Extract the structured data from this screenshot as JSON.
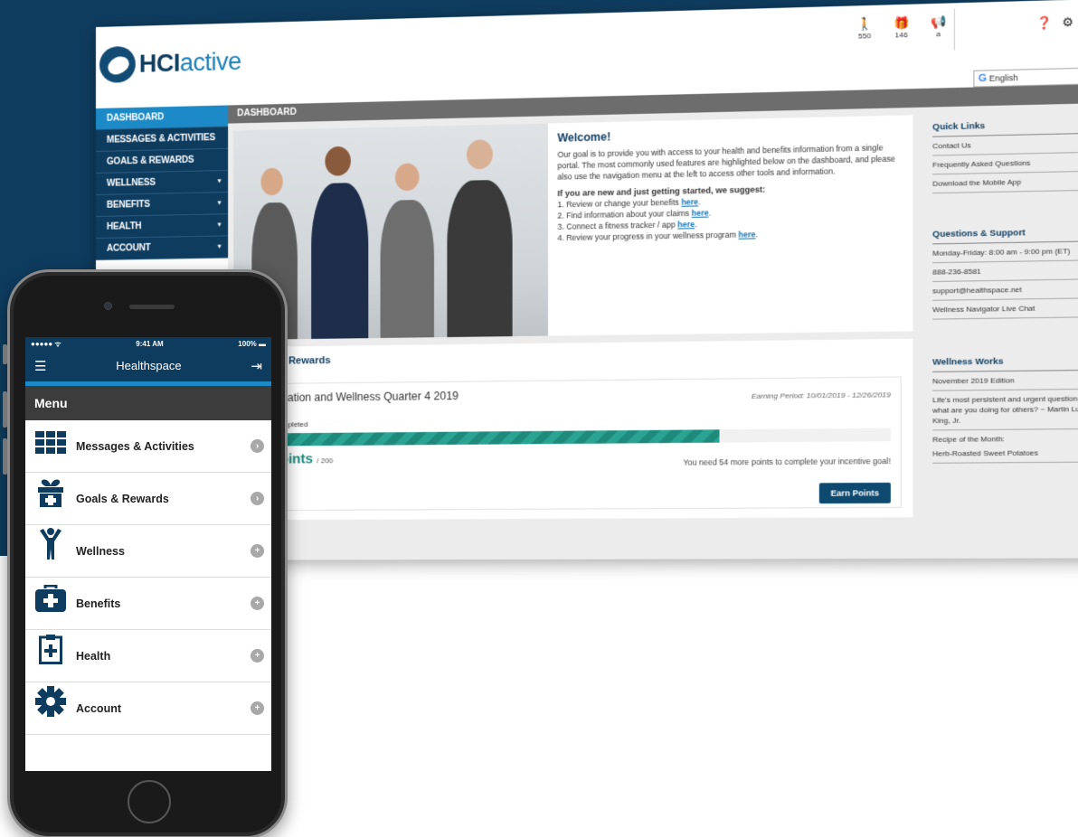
{
  "desktop": {
    "logo": {
      "bold": "HCI",
      "rest": "active"
    },
    "stats": [
      {
        "icon": "walker-icon",
        "glyph": "🚶",
        "value": "550"
      },
      {
        "icon": "gift-icon",
        "glyph": "🎁",
        "value": "146"
      },
      {
        "icon": "megaphone-icon",
        "glyph": "📢",
        "value": "a"
      }
    ],
    "language": {
      "g": "G",
      "label": "English",
      "caret": "▼"
    },
    "sidebar": [
      {
        "label": "DASHBOARD",
        "active": true,
        "arrow": ""
      },
      {
        "label": "MESSAGES & ACTIVITIES",
        "arrow": ""
      },
      {
        "label": "GOALS & REWARDS",
        "arrow": ""
      },
      {
        "label": "WELLNESS",
        "arrow": "▾"
      },
      {
        "label": "BENEFITS",
        "arrow": "▾"
      },
      {
        "label": "HEALTH",
        "arrow": "▾"
      },
      {
        "label": "ACCOUNT",
        "arrow": "▾"
      }
    ],
    "breadcrumb": "DASHBOARD",
    "welcome": {
      "title": "Welcome!",
      "body": "Our goal is to provide you with access to your health and benefits information from a single portal. The most commonly used features are highlighted below on the dashboard, and please also use the navigation menu at the left to access other tools and information.",
      "subtitle": "If you are new and just getting started, we suggest:",
      "steps": [
        {
          "text": "1. Review or change your benefits ",
          "link": "here",
          "end": "."
        },
        {
          "text": "2. Find information about your claims ",
          "link": "here",
          "end": "."
        },
        {
          "text": "3. Connect a fitness tracker / app ",
          "link": "here",
          "end": "."
        },
        {
          "text": "4. Review your progress in your wellness program ",
          "link": "here",
          "end": "."
        }
      ]
    },
    "rewards": {
      "title": "s & Rewards",
      "program": "cation and Wellness Quarter 4 2019",
      "earning_period": "Earning Period: 10/01/2019 - 12/26/2019",
      "completed_label": "mpleted",
      "progress_fraction": 0.73,
      "points_label": "oints",
      "points_total": "/ 200",
      "need_text": "You need 54 more points to complete your incentive goal!",
      "earn_button": "Earn Points"
    },
    "quick_links": {
      "title": "Quick Links",
      "items": [
        "Contact Us",
        "Frequently Asked Questions",
        "Download the Mobile App"
      ]
    },
    "support": {
      "title": "Questions & Support",
      "items": [
        "Monday-Friday: 8:00 am - 9:00 pm (ET)",
        "888-236-8581",
        "support@healthspace.net",
        "Wellness Navigator Live Chat"
      ]
    },
    "wellness_works": {
      "title": "Wellness Works",
      "items": [
        "November 2019 Edition",
        "Life's most persistent and urgent question is, what are you doing for others? ~ Martin Luther King, Jr.",
        "Recipe of the Month:",
        "Herb-Roasted Sweet Potatoes"
      ]
    }
  },
  "phone": {
    "status": {
      "signal": "●●●●● ᯤ",
      "time": "9:41 AM",
      "battery": "100% ▬"
    },
    "app_title": "Healthspace",
    "menu_glyph": "☰",
    "logout_glyph": "⇥",
    "menu_header": "Menu",
    "items": [
      {
        "label": "Messages & Activities",
        "icon": "grid-icon",
        "arrow": "›"
      },
      {
        "label": "Goals & Rewards",
        "icon": "gift-icon",
        "arrow": "›"
      },
      {
        "label": "Wellness",
        "icon": "person-icon",
        "arrow": "+"
      },
      {
        "label": "Benefits",
        "icon": "medkit-icon",
        "arrow": "+"
      },
      {
        "label": "Health",
        "icon": "clipboard-plus-icon",
        "arrow": "+"
      },
      {
        "label": "Account",
        "icon": "gear-icon",
        "arrow": "+"
      }
    ]
  },
  "colors": {
    "navy": "#0e3c5f",
    "accent": "#1b8ac7",
    "teal": "#1d8a7c"
  }
}
